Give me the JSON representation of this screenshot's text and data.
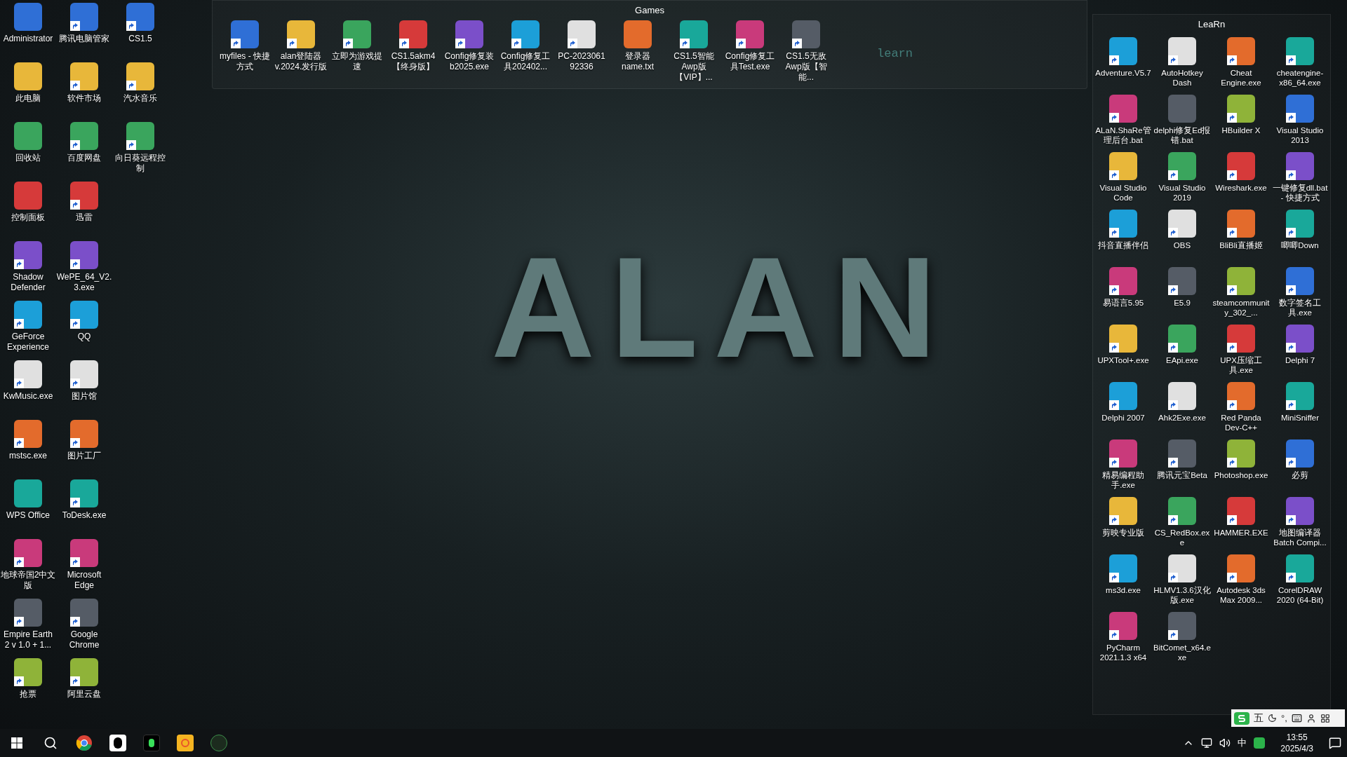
{
  "wallpaper": {
    "title": "ALAN",
    "caption": "learn"
  },
  "desktop_icons": [
    {
      "label": "Administrator",
      "shortcut": false
    },
    {
      "label": "此电脑",
      "shortcut": false
    },
    {
      "label": "回收站",
      "shortcut": false
    },
    {
      "label": "控制面板",
      "shortcut": false
    },
    {
      "label": "Shadow Defender",
      "shortcut": true
    },
    {
      "label": "GeForce Experience",
      "shortcut": true
    },
    {
      "label": "KwMusic.exe",
      "shortcut": true
    },
    {
      "label": "mstsc.exe",
      "shortcut": true
    },
    {
      "label": "WPS Office",
      "shortcut": false
    },
    {
      "label": "地球帝国2中文版",
      "shortcut": true
    },
    {
      "label": "Empire Earth 2 v 1.0 + 1...",
      "shortcut": true
    },
    {
      "label": "抢票",
      "shortcut": true
    },
    {
      "label": "腾讯电脑管家",
      "shortcut": true
    },
    {
      "label": "软件市场",
      "shortcut": true
    },
    {
      "label": "百度网盘",
      "shortcut": true
    },
    {
      "label": "迅雷",
      "shortcut": true
    },
    {
      "label": "WePE_64_V2.3.exe",
      "shortcut": true
    },
    {
      "label": "QQ",
      "shortcut": true
    },
    {
      "label": "图片馆",
      "shortcut": true
    },
    {
      "label": "图片工厂",
      "shortcut": true
    },
    {
      "label": "ToDesk.exe",
      "shortcut": true
    },
    {
      "label": "Microsoft Edge",
      "shortcut": true
    },
    {
      "label": "Google Chrome",
      "shortcut": true
    },
    {
      "label": "阿里云盘",
      "shortcut": true
    },
    {
      "label": "CS1.5",
      "shortcut": true
    },
    {
      "label": "汽水音乐",
      "shortcut": true
    },
    {
      "label": "向日葵远程控制",
      "shortcut": true
    }
  ],
  "fences": [
    {
      "title": "Games",
      "icons": [
        {
          "label": "myfiles - 快捷方式",
          "shortcut": true
        },
        {
          "label": "alan登陆器v.2024.发行版",
          "shortcut": true
        },
        {
          "label": "立即为游戏提速",
          "shortcut": true
        },
        {
          "label": "CS1.5akm4【终身版】",
          "shortcut": true
        },
        {
          "label": "Config修复装b2025.exe",
          "shortcut": true
        },
        {
          "label": "Config修复工具202402...",
          "shortcut": true
        },
        {
          "label": "PC-2023061 92336",
          "shortcut": true
        },
        {
          "label": "登录器name.txt",
          "shortcut": false
        },
        {
          "label": "CS1.5智能Awp版【VIP】...",
          "shortcut": true
        },
        {
          "label": "Config修复工具Test.exe",
          "shortcut": true
        },
        {
          "label": "CS1.5无敌Awp版【智能...",
          "shortcut": true
        }
      ]
    },
    {
      "title": "LeaRn",
      "icons": [
        {
          "label": "Adventure.V5.7",
          "shortcut": true
        },
        {
          "label": "AutoHotkey Dash",
          "shortcut": true
        },
        {
          "label": "Cheat Engine.exe",
          "shortcut": true
        },
        {
          "label": "cheatengine-x86_64.exe",
          "shortcut": true
        },
        {
          "label": "ALaN.ShaRe管理后台.bat",
          "shortcut": true
        },
        {
          "label": "delphi修复Ed报错.bat",
          "shortcut": false
        },
        {
          "label": "HBuilder X",
          "shortcut": true
        },
        {
          "label": "Visual Studio 2013",
          "shortcut": true
        },
        {
          "label": "Visual Studio Code",
          "shortcut": true
        },
        {
          "label": "Visual Studio 2019",
          "shortcut": true
        },
        {
          "label": "Wireshark.exe",
          "shortcut": true
        },
        {
          "label": "一键修复dll.bat - 快捷方式",
          "shortcut": true
        },
        {
          "label": "抖音直播伴侣",
          "shortcut": true
        },
        {
          "label": "OBS",
          "shortcut": true
        },
        {
          "label": "BliBli直播姬",
          "shortcut": true
        },
        {
          "label": "唧唧Down",
          "shortcut": true
        },
        {
          "label": "易语言5.95",
          "shortcut": true
        },
        {
          "label": "E5.9",
          "shortcut": true
        },
        {
          "label": "steamcommunity_302_...",
          "shortcut": true
        },
        {
          "label": "数字签名工具.exe",
          "shortcut": true
        },
        {
          "label": "UPXTool+.exe",
          "shortcut": true
        },
        {
          "label": "EApi.exe",
          "shortcut": true
        },
        {
          "label": "UPX压缩工具.exe",
          "shortcut": true
        },
        {
          "label": "Delphi 7",
          "shortcut": true
        },
        {
          "label": "Delphi 2007",
          "shortcut": true
        },
        {
          "label": "Ahk2Exe.exe",
          "shortcut": true
        },
        {
          "label": "Red Panda Dev-C++",
          "shortcut": true
        },
        {
          "label": "MiniSniffer",
          "shortcut": true
        },
        {
          "label": "精易编程助手.exe",
          "shortcut": true
        },
        {
          "label": "腾讯元宝Beta",
          "shortcut": true
        },
        {
          "label": "Photoshop.exe",
          "shortcut": true
        },
        {
          "label": "必剪",
          "shortcut": true
        },
        {
          "label": "剪映专业版",
          "shortcut": true
        },
        {
          "label": "CS_RedBox.exe",
          "shortcut": true
        },
        {
          "label": "HAMMER.EXE",
          "shortcut": true
        },
        {
          "label": "地图编译器Batch Compi...",
          "shortcut": true
        },
        {
          "label": "ms3d.exe",
          "shortcut": true
        },
        {
          "label": "HLMV1.3.6汉化版.exe",
          "shortcut": true
        },
        {
          "label": "Autodesk 3ds Max 2009...",
          "shortcut": true
        },
        {
          "label": "CorelDRAW 2020 (64-Bit)",
          "shortcut": true
        },
        {
          "label": "PyCharm 2021.1.3 x64",
          "shortcut": true
        },
        {
          "label": "BitComet_x64.exe",
          "shortcut": true
        }
      ]
    }
  ],
  "ime_bar": {
    "mode": "五",
    "punctuation": "°,"
  },
  "taskbar": {
    "input_language": "中",
    "time": "13:55",
    "date": "2025/4/3"
  }
}
